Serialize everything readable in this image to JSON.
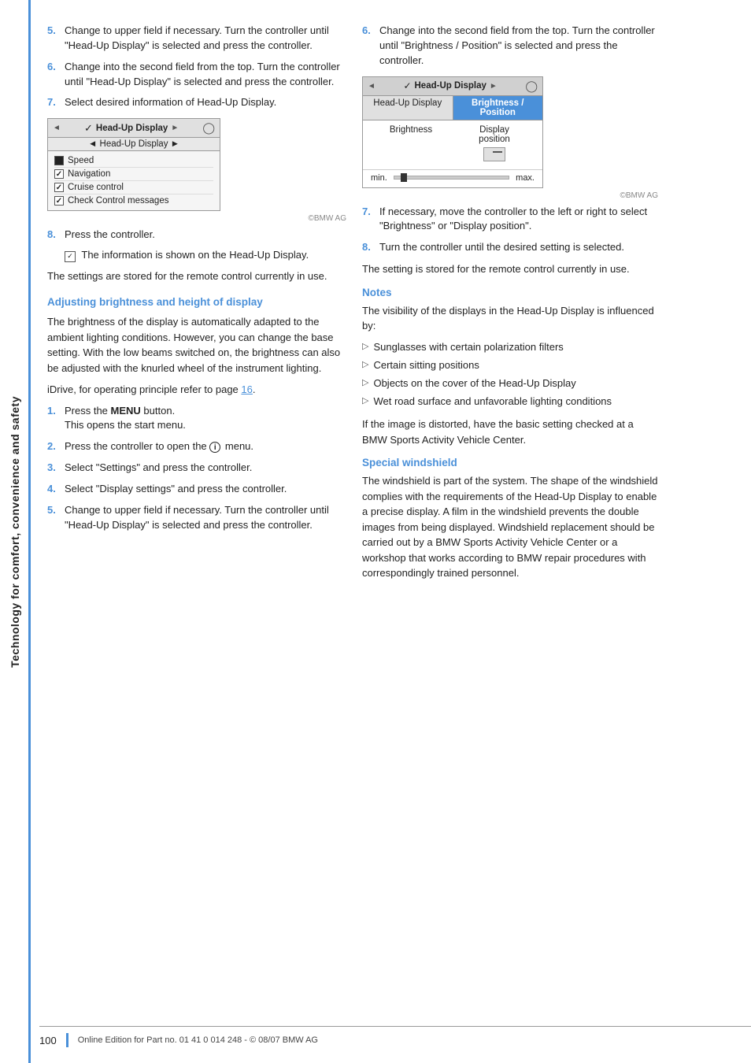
{
  "sidebar": {
    "text": "Technology for comfort, convenience and safety"
  },
  "left_col": {
    "steps_top": [
      {
        "num": "5.",
        "text": "Change to upper field if necessary. Turn the controller until \"Head-Up Display\" is selected and press the controller."
      },
      {
        "num": "6.",
        "text": "Change into the second field from the top. Turn the controller until \"Head-Up Display\" is selected and press the controller."
      },
      {
        "num": "7.",
        "text": "Select desired information of Head-Up Display."
      }
    ],
    "hud_box": {
      "title_left_arrow": "◄",
      "title_icon": "▣",
      "title_text": "Head-Up Display",
      "title_right_arrow": "►",
      "subtitle": "◄ Head-Up Display ►",
      "items": [
        {
          "type": "speed",
          "label": "Speed"
        },
        {
          "type": "checked",
          "label": "Navigation"
        },
        {
          "type": "checked",
          "label": "Cruise control"
        },
        {
          "type": "checked",
          "label": "Check Control messages"
        }
      ]
    },
    "step8": {
      "num": "8.",
      "text": "Press the controller.",
      "info_text": "The information is shown on the Head-Up Display."
    },
    "para1": "The settings are stored for the remote control currently in use.",
    "section_heading": "Adjusting brightness and height of display",
    "para2": "The brightness of the display is automatically adapted to the ambient lighting conditions. However, you can change the base setting. With the low beams switched on, the brightness can also be adjusted with the knurled wheel of the instrument lighting.",
    "idrive_text": "iDrive, for operating principle refer to page",
    "idrive_page": "16",
    "steps_bottom": [
      {
        "num": "1.",
        "text": "Press the MENU button.\nThis opens the start menu."
      },
      {
        "num": "2.",
        "text": "Press the controller to open the i menu."
      },
      {
        "num": "3.",
        "text": "Select \"Settings\" and press the controller."
      },
      {
        "num": "4.",
        "text": "Select \"Display settings\" and press the controller."
      },
      {
        "num": "5.",
        "text": "Change to upper field if necessary. Turn the controller until \"Head-Up Display\" is selected and press the controller."
      }
    ]
  },
  "right_col": {
    "step6": {
      "num": "6.",
      "text": "Change into the second field from the top. Turn the controller until \"Brightness / Position\" is selected and press the controller."
    },
    "hud_settings": {
      "title_left": "◄",
      "title_icon": "▣",
      "title_text": "Head-Up Display",
      "title_right": "►",
      "tab1": "Head-Up Display",
      "tab2": "Brightness / Position",
      "col1_label": "Brightness",
      "col2_label": "Display\nposition",
      "slider_min": "min.",
      "slider_max": "max."
    },
    "step7": {
      "num": "7.",
      "text": "If necessary, move the controller to the left or right to select \"Brightness\" or \"Display position\"."
    },
    "step8": {
      "num": "8.",
      "text": "Turn the controller until the desired setting is selected."
    },
    "para_setting": "The setting is stored for the remote control currently in use.",
    "notes_heading": "Notes",
    "notes_intro": "The visibility of the displays in the Head-Up Display is influenced by:",
    "notes_items": [
      "Sunglasses with certain polarization filters",
      "Certain sitting positions",
      "Objects on the cover of the Head-Up Display",
      "Wet road surface and unfavorable lighting conditions"
    ],
    "notes_footer": "If the image is distorted, have the basic setting checked at a BMW Sports Activity Vehicle Center.",
    "special_heading": "Special windshield",
    "special_text": "The windshield is part of the system. The shape of the windshield complies with the requirements of the Head-Up Display to enable a precise display. A film in the windshield prevents the double images from being displayed. Windshield replacement should be carried out by a BMW Sports Activity Vehicle Center or a workshop that works according to BMW repair procedures with correspondingly trained personnel."
  },
  "footer": {
    "page_num": "100",
    "text": "Online Edition for Part no. 01 41 0 014 248 - © 08/07 BMW AG"
  }
}
